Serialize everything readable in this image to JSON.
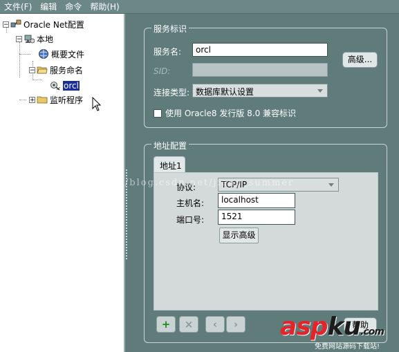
{
  "menu": {
    "file": "文件(F)",
    "edit": "编辑",
    "command": "命令",
    "help": "帮助(H)"
  },
  "tree": {
    "root": "Oracle Net配置",
    "local": "本地",
    "profile": "概要文件",
    "service_naming": "服务命名",
    "orcl": "orcl",
    "listeners": "监听程序"
  },
  "service_id": {
    "legend": "服务标识",
    "service_name_label": "服务名:",
    "service_name_value": "orcl",
    "sid_label": "SID:",
    "sid_value": "",
    "conn_type_label": "连接类型:",
    "conn_type_value": "数据库默认设置",
    "advanced_button": "高级...",
    "compat_checkbox_label": "使用 Oracle8 发行版 8.0 兼容标识"
  },
  "address": {
    "legend": "地址配置",
    "tab_label": "地址1",
    "protocol_label": "协议:",
    "protocol_value": "TCP/IP",
    "host_label": "主机名:",
    "host_value": "localhost",
    "port_label": "端口号:",
    "port_value": "1521",
    "show_advanced_button": "显示高级",
    "help_button": "帮助"
  },
  "toolbar": {
    "add_symbol": "+",
    "remove_symbol": "×",
    "prev_symbol": "‹",
    "next_symbol": "›"
  },
  "watermark": "http://blog.csdn.net/jiang_summer",
  "logo": {
    "main_a": "asp",
    "main_b": "ku",
    "dot": ".com",
    "sub": "免费网站源码下载站!"
  }
}
